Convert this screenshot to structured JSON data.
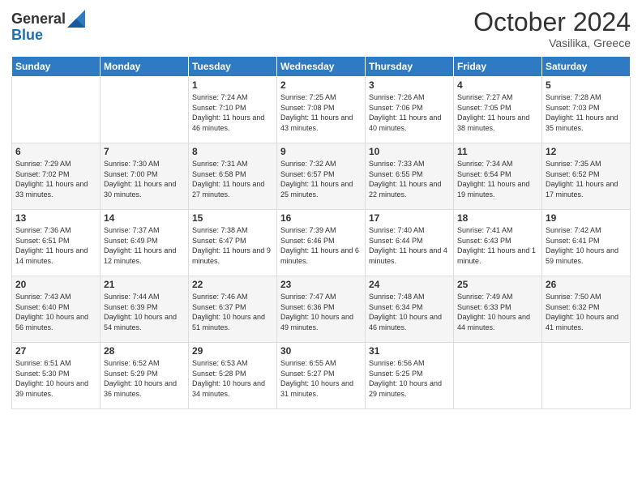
{
  "header": {
    "logo_general": "General",
    "logo_blue": "Blue",
    "month": "October 2024",
    "location": "Vasilika, Greece"
  },
  "weekdays": [
    "Sunday",
    "Monday",
    "Tuesday",
    "Wednesday",
    "Thursday",
    "Friday",
    "Saturday"
  ],
  "weeks": [
    [
      {
        "day": "",
        "sunrise": "",
        "sunset": "",
        "daylight": ""
      },
      {
        "day": "",
        "sunrise": "",
        "sunset": "",
        "daylight": ""
      },
      {
        "day": "1",
        "sunrise": "Sunrise: 7:24 AM",
        "sunset": "Sunset: 7:10 PM",
        "daylight": "Daylight: 11 hours and 46 minutes."
      },
      {
        "day": "2",
        "sunrise": "Sunrise: 7:25 AM",
        "sunset": "Sunset: 7:08 PM",
        "daylight": "Daylight: 11 hours and 43 minutes."
      },
      {
        "day": "3",
        "sunrise": "Sunrise: 7:26 AM",
        "sunset": "Sunset: 7:06 PM",
        "daylight": "Daylight: 11 hours and 40 minutes."
      },
      {
        "day": "4",
        "sunrise": "Sunrise: 7:27 AM",
        "sunset": "Sunset: 7:05 PM",
        "daylight": "Daylight: 11 hours and 38 minutes."
      },
      {
        "day": "5",
        "sunrise": "Sunrise: 7:28 AM",
        "sunset": "Sunset: 7:03 PM",
        "daylight": "Daylight: 11 hours and 35 minutes."
      }
    ],
    [
      {
        "day": "6",
        "sunrise": "Sunrise: 7:29 AM",
        "sunset": "Sunset: 7:02 PM",
        "daylight": "Daylight: 11 hours and 33 minutes."
      },
      {
        "day": "7",
        "sunrise": "Sunrise: 7:30 AM",
        "sunset": "Sunset: 7:00 PM",
        "daylight": "Daylight: 11 hours and 30 minutes."
      },
      {
        "day": "8",
        "sunrise": "Sunrise: 7:31 AM",
        "sunset": "Sunset: 6:58 PM",
        "daylight": "Daylight: 11 hours and 27 minutes."
      },
      {
        "day": "9",
        "sunrise": "Sunrise: 7:32 AM",
        "sunset": "Sunset: 6:57 PM",
        "daylight": "Daylight: 11 hours and 25 minutes."
      },
      {
        "day": "10",
        "sunrise": "Sunrise: 7:33 AM",
        "sunset": "Sunset: 6:55 PM",
        "daylight": "Daylight: 11 hours and 22 minutes."
      },
      {
        "day": "11",
        "sunrise": "Sunrise: 7:34 AM",
        "sunset": "Sunset: 6:54 PM",
        "daylight": "Daylight: 11 hours and 19 minutes."
      },
      {
        "day": "12",
        "sunrise": "Sunrise: 7:35 AM",
        "sunset": "Sunset: 6:52 PM",
        "daylight": "Daylight: 11 hours and 17 minutes."
      }
    ],
    [
      {
        "day": "13",
        "sunrise": "Sunrise: 7:36 AM",
        "sunset": "Sunset: 6:51 PM",
        "daylight": "Daylight: 11 hours and 14 minutes."
      },
      {
        "day": "14",
        "sunrise": "Sunrise: 7:37 AM",
        "sunset": "Sunset: 6:49 PM",
        "daylight": "Daylight: 11 hours and 12 minutes."
      },
      {
        "day": "15",
        "sunrise": "Sunrise: 7:38 AM",
        "sunset": "Sunset: 6:47 PM",
        "daylight": "Daylight: 11 hours and 9 minutes."
      },
      {
        "day": "16",
        "sunrise": "Sunrise: 7:39 AM",
        "sunset": "Sunset: 6:46 PM",
        "daylight": "Daylight: 11 hours and 6 minutes."
      },
      {
        "day": "17",
        "sunrise": "Sunrise: 7:40 AM",
        "sunset": "Sunset: 6:44 PM",
        "daylight": "Daylight: 11 hours and 4 minutes."
      },
      {
        "day": "18",
        "sunrise": "Sunrise: 7:41 AM",
        "sunset": "Sunset: 6:43 PM",
        "daylight": "Daylight: 11 hours and 1 minute."
      },
      {
        "day": "19",
        "sunrise": "Sunrise: 7:42 AM",
        "sunset": "Sunset: 6:41 PM",
        "daylight": "Daylight: 10 hours and 59 minutes."
      }
    ],
    [
      {
        "day": "20",
        "sunrise": "Sunrise: 7:43 AM",
        "sunset": "Sunset: 6:40 PM",
        "daylight": "Daylight: 10 hours and 56 minutes."
      },
      {
        "day": "21",
        "sunrise": "Sunrise: 7:44 AM",
        "sunset": "Sunset: 6:39 PM",
        "daylight": "Daylight: 10 hours and 54 minutes."
      },
      {
        "day": "22",
        "sunrise": "Sunrise: 7:46 AM",
        "sunset": "Sunset: 6:37 PM",
        "daylight": "Daylight: 10 hours and 51 minutes."
      },
      {
        "day": "23",
        "sunrise": "Sunrise: 7:47 AM",
        "sunset": "Sunset: 6:36 PM",
        "daylight": "Daylight: 10 hours and 49 minutes."
      },
      {
        "day": "24",
        "sunrise": "Sunrise: 7:48 AM",
        "sunset": "Sunset: 6:34 PM",
        "daylight": "Daylight: 10 hours and 46 minutes."
      },
      {
        "day": "25",
        "sunrise": "Sunrise: 7:49 AM",
        "sunset": "Sunset: 6:33 PM",
        "daylight": "Daylight: 10 hours and 44 minutes."
      },
      {
        "day": "26",
        "sunrise": "Sunrise: 7:50 AM",
        "sunset": "Sunset: 6:32 PM",
        "daylight": "Daylight: 10 hours and 41 minutes."
      }
    ],
    [
      {
        "day": "27",
        "sunrise": "Sunrise: 6:51 AM",
        "sunset": "Sunset: 5:30 PM",
        "daylight": "Daylight: 10 hours and 39 minutes."
      },
      {
        "day": "28",
        "sunrise": "Sunrise: 6:52 AM",
        "sunset": "Sunset: 5:29 PM",
        "daylight": "Daylight: 10 hours and 36 minutes."
      },
      {
        "day": "29",
        "sunrise": "Sunrise: 6:53 AM",
        "sunset": "Sunset: 5:28 PM",
        "daylight": "Daylight: 10 hours and 34 minutes."
      },
      {
        "day": "30",
        "sunrise": "Sunrise: 6:55 AM",
        "sunset": "Sunset: 5:27 PM",
        "daylight": "Daylight: 10 hours and 31 minutes."
      },
      {
        "day": "31",
        "sunrise": "Sunrise: 6:56 AM",
        "sunset": "Sunset: 5:25 PM",
        "daylight": "Daylight: 10 hours and 29 minutes."
      },
      {
        "day": "",
        "sunrise": "",
        "sunset": "",
        "daylight": ""
      },
      {
        "day": "",
        "sunrise": "",
        "sunset": "",
        "daylight": ""
      }
    ]
  ]
}
